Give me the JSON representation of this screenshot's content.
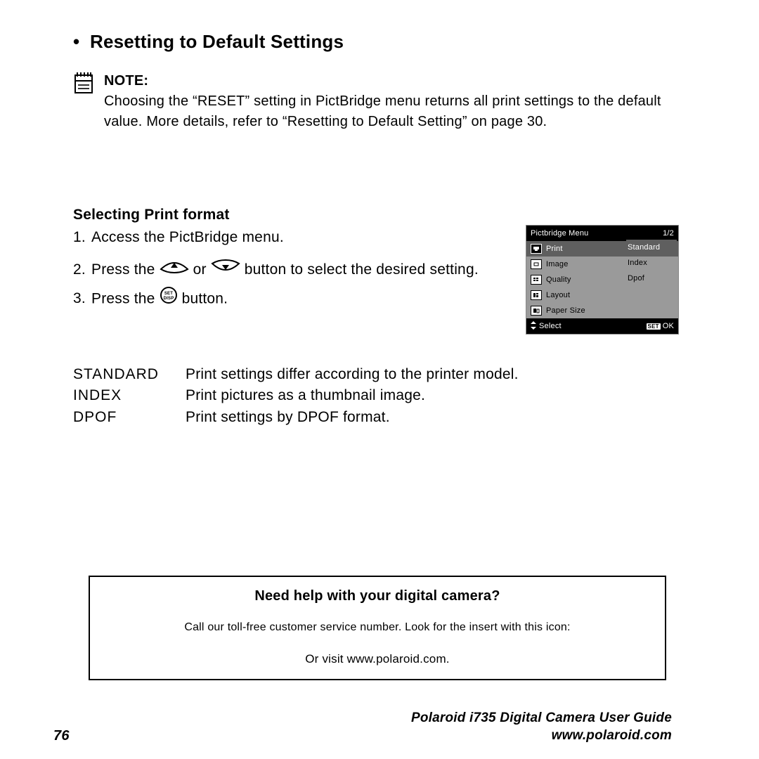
{
  "heading": "Resetting to Default Settings",
  "note": {
    "label": "NOTE:",
    "body": "Choosing the “RESET” setting in PictBridge menu returns all print settings to the default value. More details, refer to “Resetting to Default Setting” on page 30."
  },
  "subhead": "Selecting Print format",
  "steps": {
    "s1": "Access the PictBridge menu.",
    "s2a": "Press the ",
    "s2b": " or ",
    "s2c": " button to select the desired setting.",
    "s3a": "Press the ",
    "s3b": " button."
  },
  "lcd": {
    "title": "Pictbridge Menu",
    "page": "1/2",
    "items": [
      "Print",
      "Image",
      "Quality",
      "Layout",
      "Paper Size"
    ],
    "options": [
      "Standard",
      "Index",
      "Dpof"
    ],
    "footer_left": "Select",
    "footer_right": "OK",
    "footer_right_box": "SET"
  },
  "defs": [
    {
      "k": "STANDARD",
      "v": "Print settings differ according to the printer model."
    },
    {
      "k": "INDEX",
      "v": "Print pictures as a thumbnail image."
    },
    {
      "k": "DPOF",
      "v": "Print settings by DPOF format."
    }
  ],
  "help": {
    "title": "Need help with your digital camera?",
    "line1": "Call our toll-free customer service number. Look for the insert with this icon:",
    "line2": "Or visit www.polaroid.com."
  },
  "footer": {
    "page": "76",
    "guide": "Polaroid i735 Digital Camera User Guide",
    "url": "www.polaroid.com"
  }
}
